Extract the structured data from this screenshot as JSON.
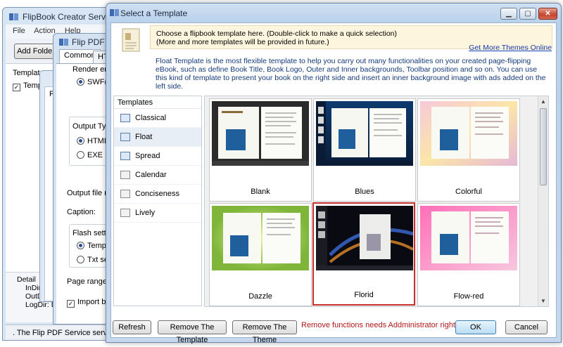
{
  "back_window_service": {
    "title": "FlipBook Creator Service",
    "menu": [
      "File",
      "Action",
      "Help"
    ],
    "add_folder_label": "Add Folder",
    "panel_label": "Template",
    "template_row_label": "Templa",
    "detail": {
      "label": "Detail",
      "in_dir": "InDir:  D:\\",
      "out_dir": "OutDir:  D:\\",
      "log_dir": "LogDir:  D:\\"
    },
    "status_text": ". The Flip PDF Service service w"
  },
  "back_window_flip": {
    "title": "Flip PDF Pa",
    "tabs": [
      "Common",
      "HTM"
    ],
    "render_engine_label": "Render eng",
    "swf_option": "SWF(d",
    "output_type_label": "Output Typ",
    "html_option": "HTML",
    "exe_option": "EXE",
    "output_file_label": "Output file na",
    "caption_label": "Caption:",
    "flash_settings_label": "Flash settin",
    "template_option": "Templa",
    "txt_option": "Txt set",
    "page_range_label": "Page range",
    "import_label": "Import bo"
  },
  "dialog": {
    "title": "Select a Template",
    "caption_buttons": [
      "minimize",
      "maximize",
      "close"
    ],
    "note_line1": "Choose a flipbook template here. (Double-click to make a quick selection)",
    "note_line2": "(More and more templates will be provided in future.)",
    "more_themes_link": "Get More Themes Online",
    "description": "Float Template is the most flexible template to help you carry out many functionalities on your created page-flipping eBook, such as define Book Title, Book Logo, Outer and Inner backgrounds, Toolbar position and so on. You can use this kind of template to present your book on the right side and insert an inner background image with ads added on the left side.",
    "templates_header": "Templates",
    "templates": [
      "Classical",
      "Float",
      "Spread",
      "Calendar",
      "Conciseness",
      "Lively"
    ],
    "selected_template": "Float",
    "themes": [
      "Blank",
      "Blues",
      "Colorful",
      "Dazzle",
      "Florid",
      "Flow-red"
    ],
    "selected_theme": "Florid",
    "buttons": {
      "refresh": "Refresh",
      "remove_template": "Remove The Template",
      "remove_theme": "Remove The Theme",
      "ok": "OK",
      "cancel": "Cancel"
    },
    "warning_text": "Remove functions needs Addministrator rights!"
  },
  "colors": {
    "accent": "#1a3fb0",
    "warning": "#b01818",
    "selection_border": "#c93030"
  }
}
